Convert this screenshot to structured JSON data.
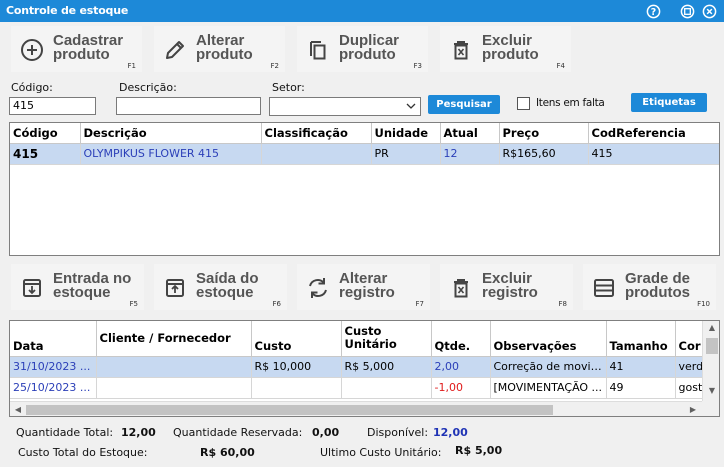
{
  "window": {
    "title": "Controle de estoque"
  },
  "toolbar_top": [
    {
      "label": "Cadastrar produto",
      "key": "F1",
      "icon": "plus-circle-icon"
    },
    {
      "label": "Alterar produto",
      "key": "F2",
      "icon": "pencil-icon"
    },
    {
      "label": "Duplicar produto",
      "key": "F3",
      "icon": "copy-icon"
    },
    {
      "label": "Excluir produto",
      "key": "F4",
      "icon": "trash-icon"
    }
  ],
  "search": {
    "codigo_label": "Código:",
    "codigo_value": "415",
    "descricao_label": "Descrição:",
    "descricao_value": "",
    "setor_label": "Setor:",
    "setor_value": "",
    "search_button": "Pesquisar",
    "missing_items_label": "Itens em falta",
    "missing_items_checked": false,
    "labels_button": "Etiquetas"
  },
  "products": {
    "columns": [
      "Código",
      "Descrição",
      "Classificação",
      "Unidade",
      "Atual",
      "Preço",
      "CodReferencia"
    ],
    "rows": [
      {
        "codigo": "415",
        "descricao": "OLYMPIKUS FLOWER 415",
        "classificacao": "",
        "unidade": "PR",
        "atual": "12",
        "preco": "R$165,60",
        "codref": "415"
      }
    ]
  },
  "toolbar_bottom": [
    {
      "label": "Entrada no estoque",
      "key": "F5",
      "icon": "inbox-in-icon"
    },
    {
      "label": "Saída do estoque",
      "key": "F6",
      "icon": "inbox-out-icon"
    },
    {
      "label": "Alterar registro",
      "key": "F7",
      "icon": "refresh-icon"
    },
    {
      "label": "Excluir registro",
      "key": "F8",
      "icon": "trash-icon"
    },
    {
      "label": "Grade de produtos",
      "key": "F10",
      "icon": "grid-icon"
    }
  ],
  "movements": {
    "columns": [
      "Data",
      "Cliente / Fornecedor",
      "Custo",
      "Custo Unitário",
      "Qtde.",
      "Observações",
      "Tamanho",
      "Cor"
    ],
    "rows": [
      {
        "data": "31/10/2023 ...",
        "cliente": "",
        "custo": "R$ 10,000",
        "custo_unit": "R$ 5,000",
        "qtde": "2,00",
        "obs": "Correção de movime...",
        "tamanho": "41",
        "cor": "verde"
      },
      {
        "data": "25/10/2023 ...",
        "cliente": "",
        "custo": "",
        "custo_unit": "",
        "qtde": "-1,00",
        "obs": "[MOVIMENTAÇÃO ...",
        "tamanho": "49",
        "cor": "gosto"
      }
    ]
  },
  "totals": {
    "qtd_total_label": "Quantidade Total:",
    "qtd_total": "12,00",
    "qtd_reservada_label": "Quantidade Reservada:",
    "qtd_reservada": "0,00",
    "disponivel_label": "Disponível:",
    "disponivel": "12,00",
    "custo_total_label": "Custo Total do Estoque:",
    "custo_total": "R$ 60,00",
    "ultimo_custo_label": "Ultimo Custo Unitário:",
    "ultimo_custo": "R$ 5,00"
  },
  "colors": {
    "titlebar": "#1d89d8",
    "accent_button": "#1d89d8",
    "selected_row": "#c7d9f1",
    "link_blue": "#2b3fb8",
    "negative_red": "#e01b1b"
  }
}
